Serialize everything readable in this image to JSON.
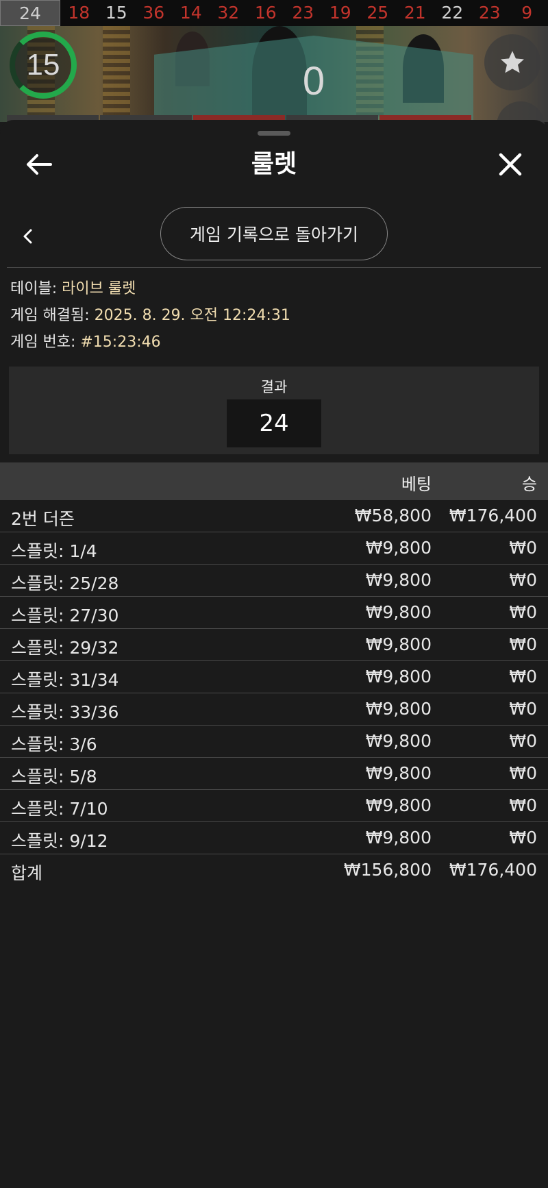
{
  "history": {
    "numbers": [
      {
        "value": "24",
        "color": "selected"
      },
      {
        "value": "18",
        "color": "red"
      },
      {
        "value": "15",
        "color": "black"
      },
      {
        "value": "36",
        "color": "red"
      },
      {
        "value": "14",
        "color": "red"
      },
      {
        "value": "32",
        "color": "red"
      },
      {
        "value": "16",
        "color": "red"
      },
      {
        "value": "23",
        "color": "red"
      },
      {
        "value": "19",
        "color": "red"
      },
      {
        "value": "25",
        "color": "red"
      },
      {
        "value": "21",
        "color": "red"
      },
      {
        "value": "22",
        "color": "black"
      },
      {
        "value": "23",
        "color": "red"
      },
      {
        "value": "9",
        "color": "red"
      }
    ]
  },
  "video": {
    "timer": "15",
    "zero_label": "0",
    "favorite_icon": "star-icon"
  },
  "sheet": {
    "title": "룰렛",
    "back_icon": "arrow-left-icon",
    "close_icon": "close-icon",
    "sub_back_icon": "chevron-left-icon",
    "history_button": "게임 기록으로 돌아가기"
  },
  "info": {
    "table_label": "테이블: ",
    "table_value": "라이브 룰렛",
    "resolved_label": "게임 해결됨: ",
    "resolved_value": "2025. 8. 29. 오전 12:24:31",
    "game_no_label": "게임 번호: ",
    "game_no_value": "#15:23:46"
  },
  "result": {
    "label": "결과",
    "value": "24"
  },
  "table": {
    "col_bet": "베팅",
    "col_win": "승",
    "rows": [
      {
        "name": "2번 더즌",
        "bet": "₩58,800",
        "win": "₩176,400"
      },
      {
        "name": "스플릿: 1/4",
        "bet": "₩9,800",
        "win": "₩0"
      },
      {
        "name": "스플릿: 25/28",
        "bet": "₩9,800",
        "win": "₩0"
      },
      {
        "name": "스플릿: 27/30",
        "bet": "₩9,800",
        "win": "₩0"
      },
      {
        "name": "스플릿: 29/32",
        "bet": "₩9,800",
        "win": "₩0"
      },
      {
        "name": "스플릿: 31/34",
        "bet": "₩9,800",
        "win": "₩0"
      },
      {
        "name": "스플릿: 33/36",
        "bet": "₩9,800",
        "win": "₩0"
      },
      {
        "name": "스플릿: 3/6",
        "bet": "₩9,800",
        "win": "₩0"
      },
      {
        "name": "스플릿: 5/8",
        "bet": "₩9,800",
        "win": "₩0"
      },
      {
        "name": "스플릿: 7/10",
        "bet": "₩9,800",
        "win": "₩0"
      },
      {
        "name": "스플릿: 9/12",
        "bet": "₩9,800",
        "win": "₩0"
      }
    ],
    "total": {
      "name": "합계",
      "bet": "₩156,800",
      "win": "₩176,400"
    }
  },
  "colors": {
    "accent_text": "#f1ddb0",
    "red_number": "#c2342c",
    "timer_green": "#23a94b"
  }
}
